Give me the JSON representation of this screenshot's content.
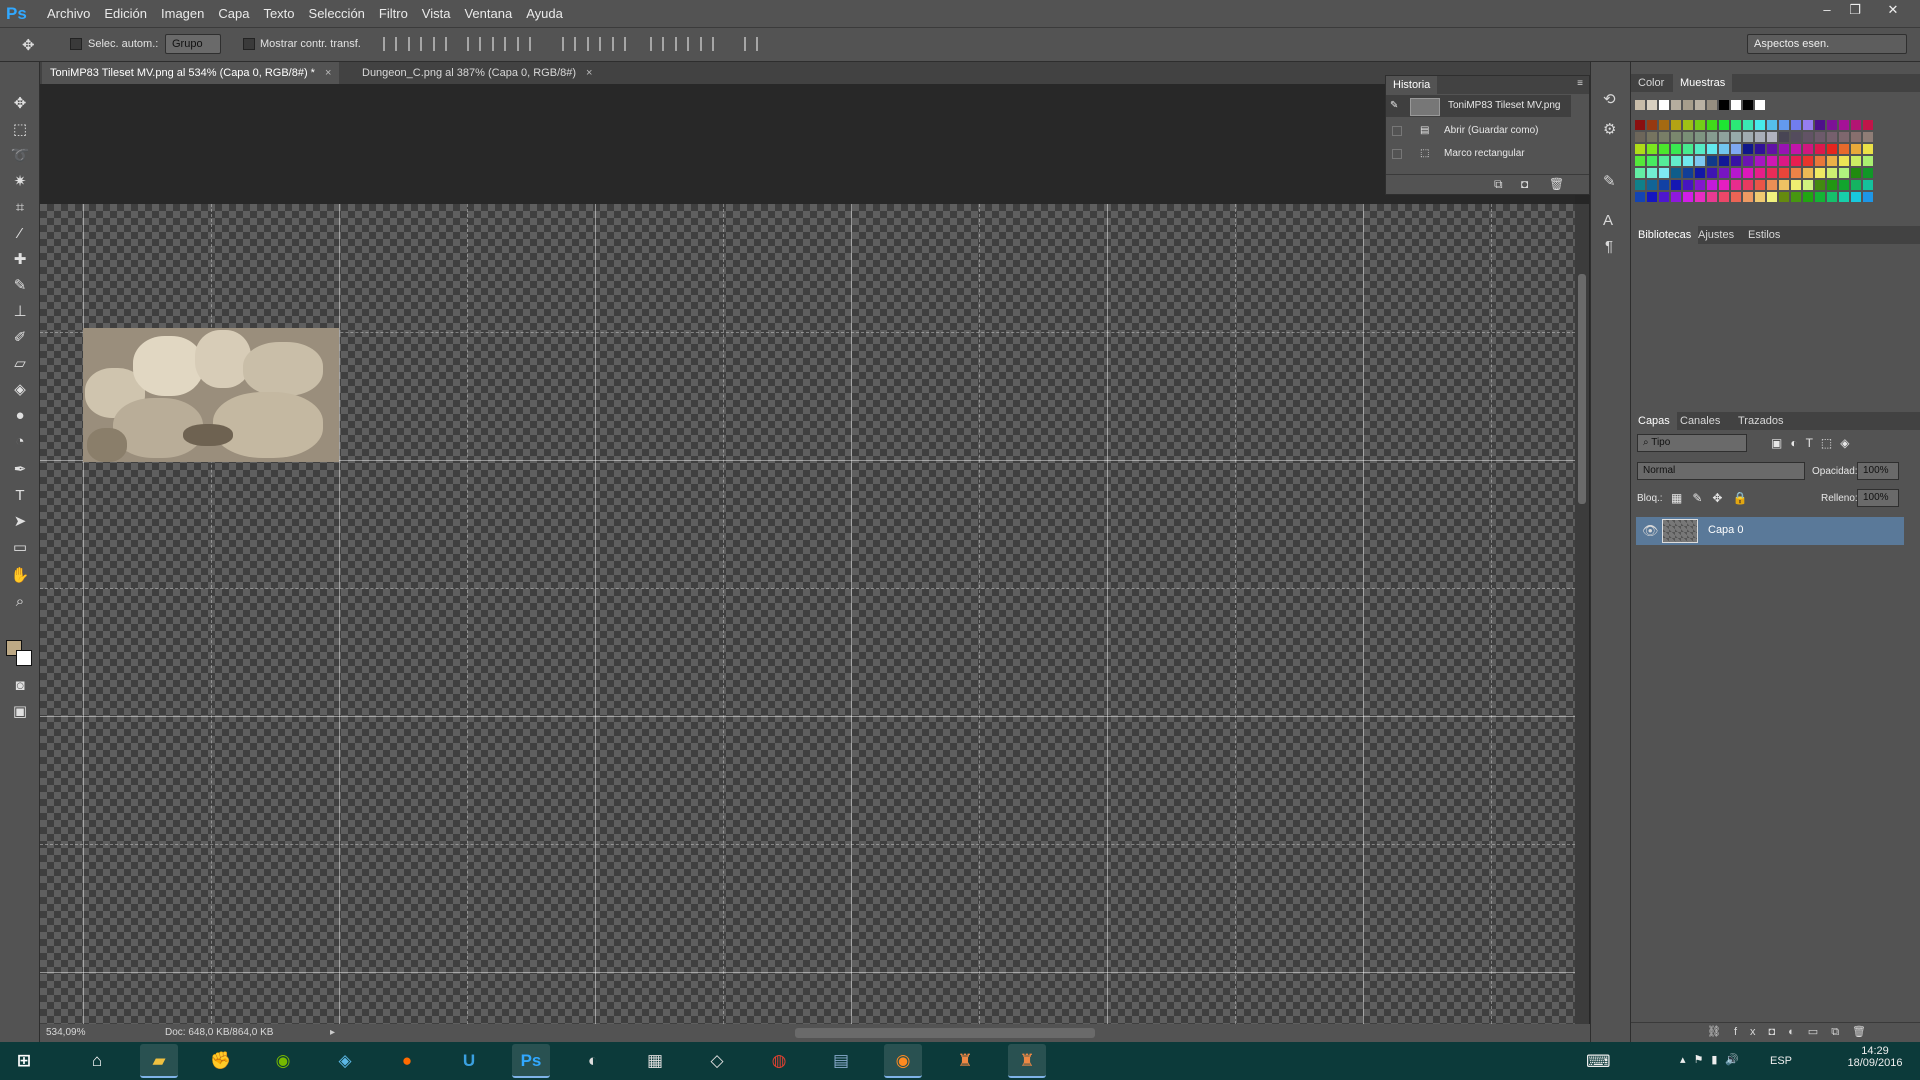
{
  "app": {
    "logo": "Ps"
  },
  "menu": [
    "Archivo",
    "Edición",
    "Imagen",
    "Capa",
    "Texto",
    "Selección",
    "Filtro",
    "Vista",
    "Ventana",
    "Ayuda"
  ],
  "options": {
    "auto_select_label": "Selec. autom.:",
    "auto_select_value": "Grupo",
    "transform_label": "Mostrar contr. transf.",
    "workspace": "Aspectos esen."
  },
  "tabs": [
    {
      "label": "ToniMP83 Tileset MV.png al 534% (Capa 0, RGB/8#) *",
      "active": true
    },
    {
      "label": "Dungeon_C.png al 387% (Capa 0, RGB/8#)",
      "active": false
    }
  ],
  "status": {
    "zoom": "534,09%",
    "doc": "Doc: 648,0 KB/864,0 KB"
  },
  "history": {
    "title": "Historia",
    "snapshot": "ToniMP83 Tileset MV.png",
    "items": [
      "Abrir (Guardar como)",
      "Marco rectangular"
    ]
  },
  "swatch_panel": {
    "tabs": [
      "Color",
      "Muestras"
    ]
  },
  "libraries_panel": {
    "tabs": [
      "Bibliotecas",
      "Ajustes",
      "Estilos"
    ]
  },
  "layers_panel": {
    "tabs": [
      "Capas",
      "Canales",
      "Trazados"
    ],
    "filter": "Tipo",
    "blend_mode": "Normal",
    "opacity_label": "Opacidad:",
    "opacity": "100%",
    "lock_label": "Bloq.:",
    "fill_label": "Relleno:",
    "fill": "100%",
    "layers": [
      {
        "name": "Capa 0",
        "visible": true
      }
    ]
  },
  "taskbar": {
    "lang": "ESP",
    "time": "14:29",
    "date": "18/09/2016"
  },
  "colors": {
    "accent": "#31a8ff",
    "selection": "#5a7999",
    "taskbar": "#0c3a3a"
  }
}
